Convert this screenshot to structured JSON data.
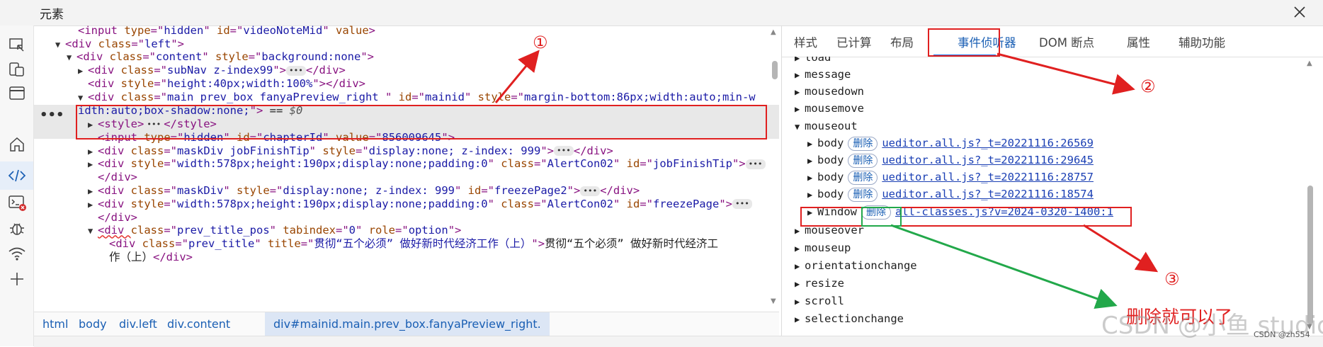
{
  "window": {
    "title": "元素"
  },
  "tree": {
    "lines": [
      {
        "i": 0,
        "indent": 62,
        "html": [
          [
            "tag",
            "<input "
          ],
          [
            "attr",
            "type"
          ],
          [
            "tag",
            "=\""
          ],
          [
            "val",
            "hidden"
          ],
          [
            "tag",
            "\" "
          ],
          [
            "attr",
            "id"
          ],
          [
            "tag",
            "=\""
          ],
          [
            "val",
            "videoNoteMid"
          ],
          [
            "tag",
            "\" "
          ],
          [
            "attr",
            "value"
          ],
          [
            "tag",
            ">"
          ]
        ]
      },
      {
        "i": 1,
        "indent": 30,
        "tri": "▼",
        "html": [
          [
            "tag",
            "<div "
          ],
          [
            "attr",
            "class"
          ],
          [
            "tag",
            "=\""
          ],
          [
            "val",
            "left"
          ],
          [
            "tag",
            "\">"
          ]
        ]
      },
      {
        "i": 2,
        "indent": 46,
        "tri": "▼",
        "html": [
          [
            "tag",
            "<div "
          ],
          [
            "attr",
            "class"
          ],
          [
            "tag",
            "=\""
          ],
          [
            "val",
            "content"
          ],
          [
            "tag",
            "\" "
          ],
          [
            "attr",
            "style"
          ],
          [
            "tag",
            "=\""
          ],
          [
            "val",
            "background:none"
          ],
          [
            "tag",
            "\">"
          ]
        ]
      },
      {
        "i": 3,
        "indent": 62,
        "tri": "▶",
        "html": [
          [
            "tag",
            "<div "
          ],
          [
            "attr",
            "class"
          ],
          [
            "tag",
            "=\""
          ],
          [
            "val",
            "subNav z-index99"
          ],
          [
            "tag",
            "\">"
          ],
          [
            "ell",
            ""
          ],
          [
            "tag",
            "</div>"
          ]
        ]
      },
      {
        "i": 4,
        "indent": 76,
        "html": [
          [
            "tag",
            "<div "
          ],
          [
            "attr",
            "style"
          ],
          [
            "tag",
            "=\""
          ],
          [
            "val",
            "height:40px;width:100%"
          ],
          [
            "tag",
            "\"></div>"
          ]
        ]
      }
    ],
    "selected": {
      "line1": [
        [
          "tag",
          "<div "
        ],
        [
          "attr",
          "class"
        ],
        [
          "tag",
          "=\""
        ],
        [
          "val",
          "main prev_box  fanyaPreview_right  "
        ],
        [
          "tag",
          "\" "
        ],
        [
          "attr",
          "id"
        ],
        [
          "tag",
          "=\""
        ],
        [
          "val",
          "mainid"
        ],
        [
          "tag",
          "\" "
        ],
        [
          "attr",
          "style"
        ],
        [
          "tag",
          "=\""
        ],
        [
          "val",
          "margin-bottom:86px;width:auto;min-w"
        ]
      ],
      "line2": [
        [
          "val",
          "idth:auto;box-shadow:none;"
        ],
        [
          "tag",
          "\">"
        ],
        [
          "txt",
          " == "
        ],
        [
          "dollar",
          "$0"
        ]
      ]
    },
    "lines2": [
      {
        "i": 7,
        "indent": 76,
        "tri": "▶",
        "html": [
          [
            "tag",
            "<style>"
          ],
          [
            "ell",
            ""
          ],
          [
            "tag",
            "</style>"
          ]
        ]
      },
      {
        "i": 8,
        "indent": 90,
        "html": [
          [
            "tag",
            "<input "
          ],
          [
            "attr",
            "type"
          ],
          [
            "tag",
            "=\""
          ],
          [
            "val",
            "hidden"
          ],
          [
            "tag",
            "\" "
          ],
          [
            "attr",
            "id"
          ],
          [
            "tag",
            "=\""
          ],
          [
            "val",
            "chapterId"
          ],
          [
            "tag",
            "\" "
          ],
          [
            "attr",
            "value"
          ],
          [
            "tag",
            "=\""
          ],
          [
            "val",
            "856009645"
          ],
          [
            "tag",
            "\">"
          ]
        ]
      },
      {
        "i": 9,
        "indent": 76,
        "tri": "▶",
        "html": [
          [
            "tag",
            "<div "
          ],
          [
            "attr",
            "class"
          ],
          [
            "tag",
            "=\""
          ],
          [
            "val",
            "maskDiv jobFinishTip"
          ],
          [
            "tag",
            "\" "
          ],
          [
            "attr",
            "style"
          ],
          [
            "tag",
            "=\""
          ],
          [
            "val",
            "display:none; z-index: 999"
          ],
          [
            "tag",
            "\">"
          ],
          [
            "ell",
            ""
          ],
          [
            "tag",
            "</div>"
          ]
        ]
      },
      {
        "i": 10,
        "indent": 76,
        "tri": "▶",
        "html": [
          [
            "tag",
            "<div "
          ],
          [
            "attr",
            "style"
          ],
          [
            "tag",
            "=\""
          ],
          [
            "val",
            "width:578px;height:190px;display:none;padding:0"
          ],
          [
            "tag",
            "\" "
          ],
          [
            "attr",
            "class"
          ],
          [
            "tag",
            "=\""
          ],
          [
            "val",
            "AlertCon02"
          ],
          [
            "tag",
            "\" "
          ],
          [
            "attr",
            "id"
          ],
          [
            "tag",
            "=\""
          ],
          [
            "val",
            "jobFinishTip"
          ],
          [
            "tag",
            "\">"
          ],
          [
            "ell",
            ""
          ]
        ]
      },
      {
        "i": 11,
        "indent": 90,
        "html": [
          [
            "tag",
            "</div>"
          ]
        ]
      },
      {
        "i": 12,
        "indent": 76,
        "tri": "▶",
        "html": [
          [
            "tag",
            "<div "
          ],
          [
            "attr",
            "class"
          ],
          [
            "tag",
            "=\""
          ],
          [
            "val",
            "maskDiv"
          ],
          [
            "tag",
            "\" "
          ],
          [
            "attr",
            "style"
          ],
          [
            "tag",
            "=\""
          ],
          [
            "val",
            "display:none; z-index: 999"
          ],
          [
            "tag",
            "\" "
          ],
          [
            "attr",
            "id"
          ],
          [
            "tag",
            "=\""
          ],
          [
            "val",
            "freezePage2"
          ],
          [
            "tag",
            "\">"
          ],
          [
            "ell",
            ""
          ],
          [
            "tag",
            "</div>"
          ]
        ]
      },
      {
        "i": 13,
        "indent": 76,
        "tri": "▶",
        "html": [
          [
            "tag",
            "<div "
          ],
          [
            "attr",
            "style"
          ],
          [
            "tag",
            "=\""
          ],
          [
            "val",
            "width:578px;height:190px;display:none;padding:0"
          ],
          [
            "tag",
            "\" "
          ],
          [
            "attr",
            "class"
          ],
          [
            "tag",
            "=\""
          ],
          [
            "val",
            "AlertCon02"
          ],
          [
            "tag",
            "\" "
          ],
          [
            "attr",
            "id"
          ],
          [
            "tag",
            "=\""
          ],
          [
            "val",
            "freezePage"
          ],
          [
            "tag",
            "\">"
          ],
          [
            "ell",
            ""
          ]
        ]
      },
      {
        "i": 14,
        "indent": 90,
        "html": [
          [
            "tag",
            "</div>"
          ]
        ]
      },
      {
        "i": 15,
        "indent": 76,
        "tri": "▼",
        "html": [
          [
            "tagw",
            "<div "
          ],
          [
            "attr",
            "class"
          ],
          [
            "tag",
            "=\""
          ],
          [
            "val",
            "prev_title_pos"
          ],
          [
            "tag",
            "\" "
          ],
          [
            "attr",
            "tabindex"
          ],
          [
            "tag",
            "=\""
          ],
          [
            "val",
            "0"
          ],
          [
            "tag",
            "\" "
          ],
          [
            "attr",
            "role"
          ],
          [
            "tag",
            "=\""
          ],
          [
            "val",
            "option"
          ],
          [
            "tag",
            "\">"
          ]
        ]
      },
      {
        "i": 16,
        "indent": 106,
        "html": [
          [
            "tag",
            "<div "
          ],
          [
            "attr",
            "class"
          ],
          [
            "tag",
            "=\""
          ],
          [
            "val",
            "prev_title"
          ],
          [
            "tag",
            "\" "
          ],
          [
            "attr",
            "title"
          ],
          [
            "tag",
            "=\""
          ],
          [
            "val",
            "贯彻“五个必须” 做好新时代经济工作（上）"
          ],
          [
            "tag",
            "\">"
          ],
          [
            "txt",
            "贯彻“五个必须” 做好新时代经济工"
          ]
        ]
      },
      {
        "i": 17,
        "indent": 106,
        "html": [
          [
            "txt",
            "作（上）"
          ],
          [
            "tag",
            "</div>"
          ]
        ]
      }
    ]
  },
  "breadcrumbs": [
    "html",
    "body",
    "div.left",
    "div.content",
    "div#mainid.main.prev_box.fanyaPreview_right."
  ],
  "tabs": [
    "样式",
    "已计算",
    "布局",
    "事件侦听器",
    "DOM 断点",
    "属性",
    "辅助功能"
  ],
  "active_tab": "事件侦听器",
  "listeners": {
    "events": [
      "load",
      "message",
      "mousedown",
      "mousemove",
      "mouseout",
      "mouseover",
      "mouseup",
      "orientationchange",
      "resize",
      "scroll",
      "selectionchange"
    ],
    "mouseout_items": [
      {
        "target": "body",
        "remove": "删除",
        "link": "ueditor.all.js?_t=20221116:26569"
      },
      {
        "target": "body",
        "remove": "删除",
        "link": "ueditor.all.js?_t=20221116:29645"
      },
      {
        "target": "body",
        "remove": "删除",
        "link": "ueditor.all.js?_t=20221116:28757"
      },
      {
        "target": "body",
        "remove": "删除",
        "link": "ueditor.all.js?_t=20221116:18574"
      },
      {
        "target": "Window",
        "remove": "删除",
        "link": "all-classes.js?v=2024-0320-1400:1"
      }
    ]
  },
  "annotations": {
    "one": "①",
    "two": "②",
    "three": "③",
    "note": "删除就可以了",
    "watermark": "CSDN @小鱼 studio",
    "watermark_small": "CSDN @zh554"
  },
  "colors": {
    "annotation_red": "#e02020",
    "annotation_green": "#22a84a",
    "accent": "#1a73e8"
  }
}
